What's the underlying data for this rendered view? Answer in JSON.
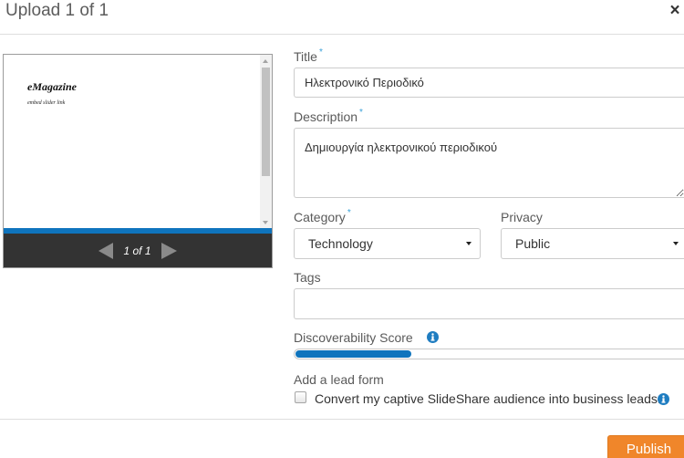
{
  "dialog": {
    "title": "Upload 1 of 1",
    "close_label": "×"
  },
  "preview": {
    "slide_title": "eMagazine",
    "slide_subtitle": "embed slider link",
    "pager": "1 of 1"
  },
  "form": {
    "title": {
      "label": "Title",
      "required_mark": "*",
      "value": "Ηλεκτρονικό Περιοδικό"
    },
    "description": {
      "label": "Description",
      "required_mark": "*",
      "value": "Δημιουργία ηλεκτρονικού περιοδικού"
    },
    "category": {
      "label": "Category",
      "required_mark": "*",
      "value": "Technology"
    },
    "privacy": {
      "label": "Privacy",
      "value": "Public"
    },
    "tags": {
      "label": "Tags",
      "value": ""
    },
    "discoverability": {
      "label": "Discoverability Score",
      "score_percent": 30
    },
    "lead_form": {
      "label": "Add a lead form",
      "checkbox_label": "Convert my captive SlideShare audience into business leads.",
      "checked": false
    }
  },
  "footer": {
    "publish_label": "Publish"
  },
  "icons": {
    "info": "info-icon",
    "prev": "previous-slide-icon",
    "next": "next-slide-icon",
    "dropdown": "chevron-down-icon"
  },
  "colors": {
    "accent_blue": "#0f74bd",
    "required_mark": "#3ba2d9",
    "info_blue": "#1f7dc1",
    "publish_orange": "#f0862a",
    "pager_bar": "#333333"
  }
}
